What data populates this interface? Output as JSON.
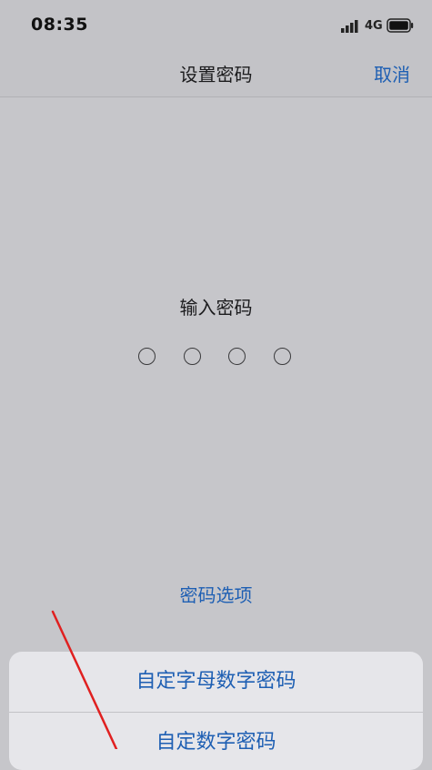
{
  "status_bar": {
    "time": "08:35",
    "network": "4G",
    "signal_icon": "signal-bars-icon",
    "battery_icon": "battery-icon"
  },
  "nav": {
    "title": "设置密码",
    "cancel_label": "取消"
  },
  "passcode": {
    "prompt": "输入密码",
    "digits_total": 4,
    "digits_entered": 0
  },
  "options_link": "密码选项",
  "action_sheet": {
    "options": [
      {
        "label": "自定字母数字密码"
      },
      {
        "label": "自定数字密码"
      }
    ]
  },
  "colors": {
    "accent": "#1e5fb3",
    "background": "#c6c6ca",
    "annotation_arrow": "#e02020"
  }
}
